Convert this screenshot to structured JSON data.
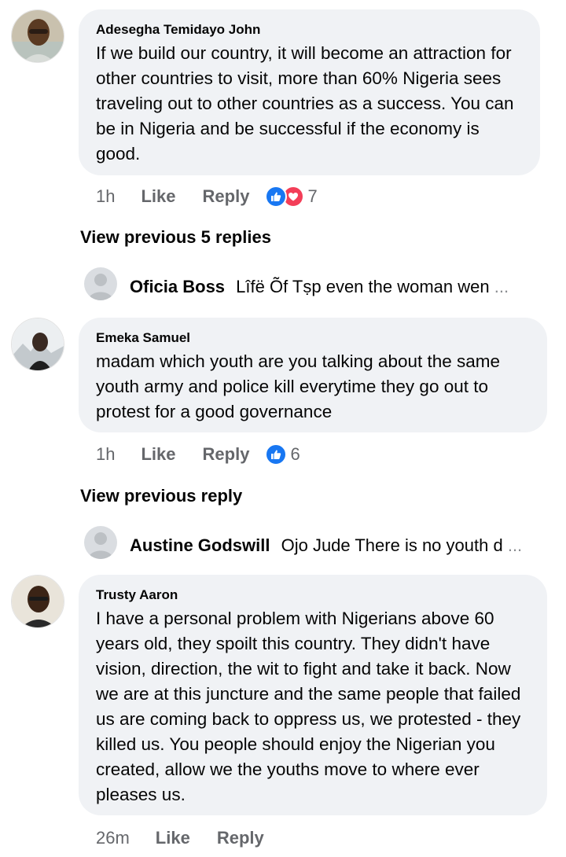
{
  "comments": [
    {
      "author": "Adesegha Temidayo John",
      "text": "If we build our country, it will become an attraction for other countries to visit, more than 60% Nigeria sees traveling out to other countries as a success. You can be in Nigeria and be successful if the economy is good.",
      "time": "1h",
      "like_label": "Like",
      "reply_label": "Reply",
      "reaction_count": "7",
      "reactions": [
        "like-icon",
        "love-icon"
      ]
    },
    {
      "author": "Emeka Samuel",
      "text": "madam which youth are you talking about the same youth army and police kill everytime they go out to protest for a good governance",
      "time": "1h",
      "like_label": "Like",
      "reply_label": "Reply",
      "reaction_count": "6",
      "reactions": [
        "like-icon"
      ]
    },
    {
      "author": "Trusty Aaron",
      "text": "I have a personal problem with Nigerians above 60 years old, they spoilt this country. They didn't have vision, direction, the wit to fight and take it back. Now we are at this juncture and the same people that failed us are coming back to oppress us, we protested - they killed us. You people should enjoy the Nigerian you created, allow we the youths move to where ever pleases us.",
      "time": "26m",
      "like_label": "Like",
      "reply_label": "Reply"
    }
  ],
  "reply_threads": [
    {
      "view_previous": "View previous 5 replies",
      "latest_reply_author": "Oficia Boss",
      "latest_reply_text": "Lîfë Õf Tṣp even the woman wen",
      "ellipsis": "..."
    },
    {
      "view_previous": "View previous reply",
      "latest_reply_author": "Austine Godswill",
      "latest_reply_text": "Ojo Jude There is no youth d",
      "ellipsis": "..."
    }
  ],
  "colors": {
    "bubble": "#f0f2f5",
    "secondary_text": "#65676b",
    "like_blue": "#1877f2",
    "love_red": "#f33e58"
  }
}
